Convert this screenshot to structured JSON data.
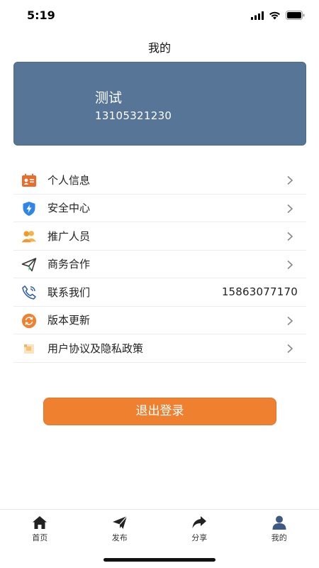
{
  "status_bar": {
    "time": "5:19"
  },
  "header": {
    "title": "我的"
  },
  "profile": {
    "name": "测试",
    "phone": "13105321230",
    "card_color": "#567597"
  },
  "menu": {
    "items": [
      {
        "label": "个人信息",
        "icon": "id-card-icon",
        "has_arrow": true
      },
      {
        "label": "安全中心",
        "icon": "shield-bolt-icon",
        "has_arrow": true
      },
      {
        "label": "推广人员",
        "icon": "people-icon",
        "has_arrow": true
      },
      {
        "label": "商务合作",
        "icon": "paper-plane-icon",
        "has_arrow": true
      },
      {
        "label": "联系我们",
        "icon": "phone-icon",
        "has_arrow": false,
        "value": "15863077170"
      },
      {
        "label": "版本更新",
        "icon": "refresh-icon",
        "has_arrow": true
      },
      {
        "label": "用户协议及隐私政策",
        "icon": "document-icon",
        "has_arrow": true
      }
    ]
  },
  "logout": {
    "label": "退出登录",
    "color": "#ef8030"
  },
  "tabs": [
    {
      "label": "首页",
      "icon": "home-icon"
    },
    {
      "label": "发布",
      "icon": "send-icon"
    },
    {
      "label": "分享",
      "icon": "share-icon"
    },
    {
      "label": "我的",
      "icon": "user-icon"
    }
  ],
  "colors": {
    "accent_orange": "#ef8030",
    "tab_active": "#3f5a80"
  }
}
